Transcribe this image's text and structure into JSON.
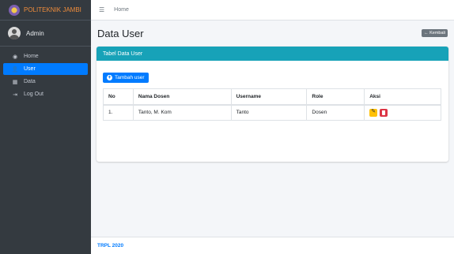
{
  "brand": {
    "name": "POLITEKNIK JAMBI"
  },
  "user": {
    "name": "Admin"
  },
  "sidebar": {
    "items": [
      {
        "label": "Home",
        "icon": "dashboard-icon",
        "active": false
      },
      {
        "label": "User",
        "icon": "user-icon",
        "active": true
      },
      {
        "label": "Data",
        "icon": "table-icon",
        "active": false
      },
      {
        "label": "Log Out",
        "icon": "logout-icon",
        "active": false
      }
    ]
  },
  "topbar": {
    "home_link": "Home"
  },
  "page": {
    "title": "Data User",
    "back_label": "← Kembali"
  },
  "card": {
    "header": "Tabel Data User",
    "add_button": "Tambah user",
    "columns": [
      "No",
      "Nama Dosen",
      "Username",
      "Role",
      "Aksi"
    ],
    "rows": [
      {
        "no": "1.",
        "nama": "Tanto, M. Kom",
        "username": "Tanto",
        "role": "Dosen"
      }
    ]
  },
  "footer": {
    "text": "TRPL 2020"
  },
  "colors": {
    "sidebar": "#343a40",
    "active": "#007bff",
    "card_header": "#17a2b8",
    "edit": "#ffc107",
    "delete": "#dc3545"
  }
}
